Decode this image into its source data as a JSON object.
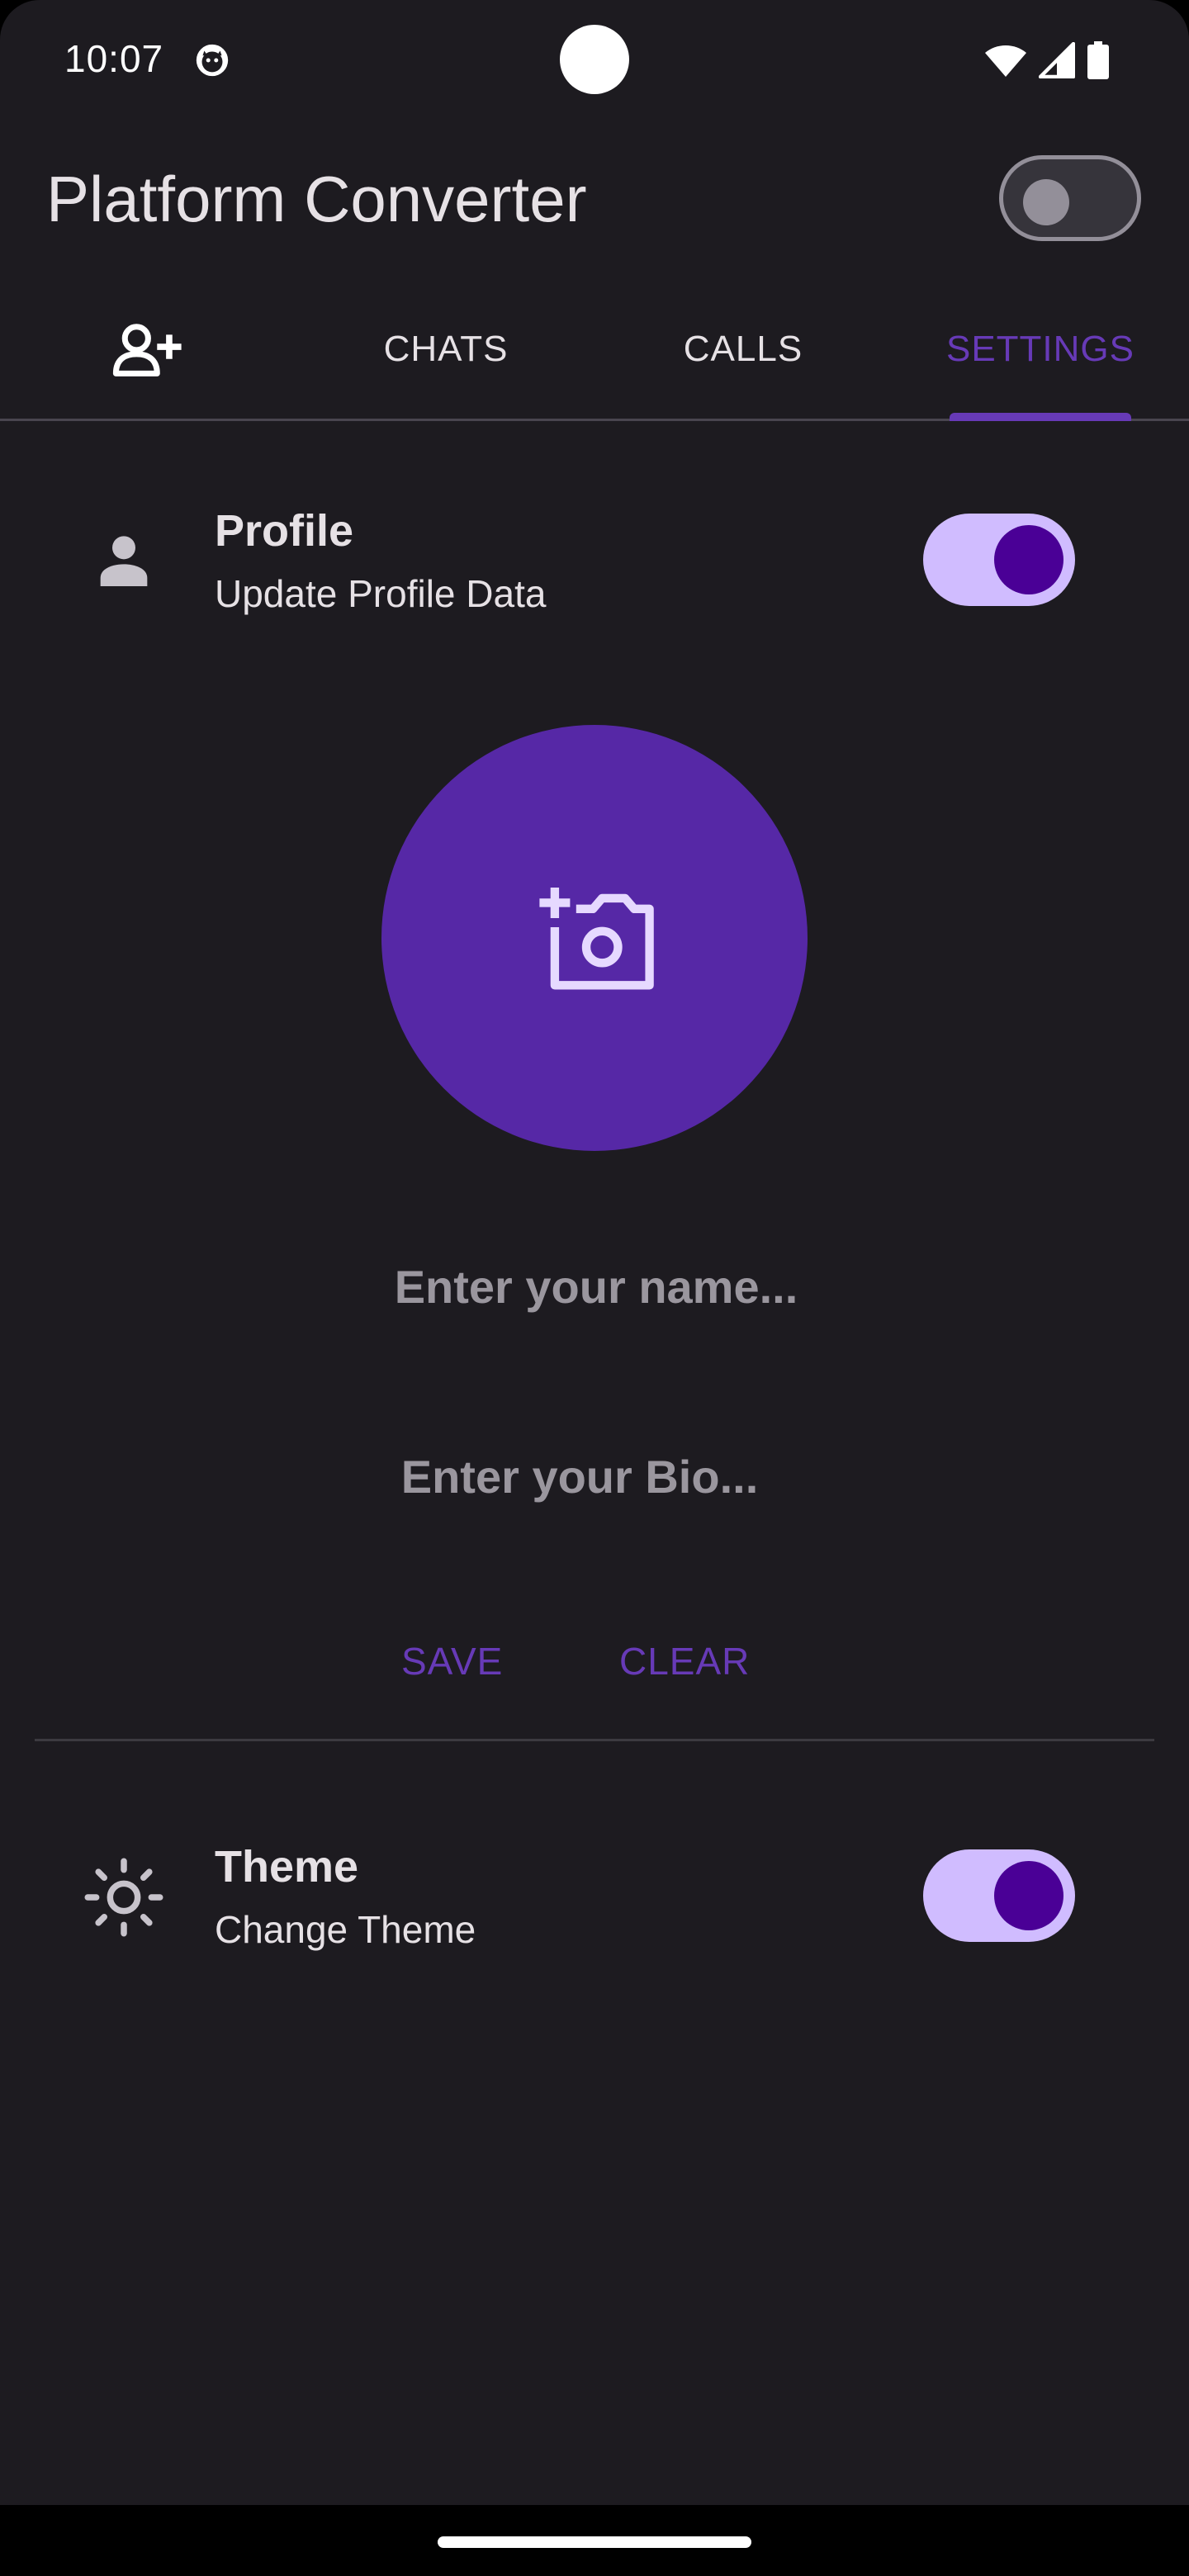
{
  "status_bar": {
    "time": "10:07",
    "icons": [
      "app-notification-icon",
      "wifi-icon",
      "signal-icon",
      "battery-icon"
    ]
  },
  "app_bar": {
    "title": "Platform Converter",
    "platform_switch_on": false
  },
  "tabs": [
    {
      "label": "",
      "icon": "person-add-icon",
      "active": false
    },
    {
      "label": "CHATS",
      "active": false
    },
    {
      "label": "CALLS",
      "active": false
    },
    {
      "label": "SETTINGS",
      "active": true
    }
  ],
  "profile": {
    "title": "Profile",
    "subtitle": "Update Profile Data",
    "enabled": true,
    "avatar_icon": "add-a-photo-icon",
    "name_placeholder": "Enter your name...",
    "bio_placeholder": "Enter your Bio...",
    "save_label": "SAVE",
    "clear_label": "CLEAR"
  },
  "theme": {
    "title": "Theme",
    "subtitle": "Change Theme",
    "enabled": true
  },
  "colors": {
    "background": "#1d1b20",
    "accent": "#673ab7",
    "avatar": "#5628a6",
    "toggle_track": "#d0bcff",
    "toggle_thumb": "#4a0096"
  }
}
